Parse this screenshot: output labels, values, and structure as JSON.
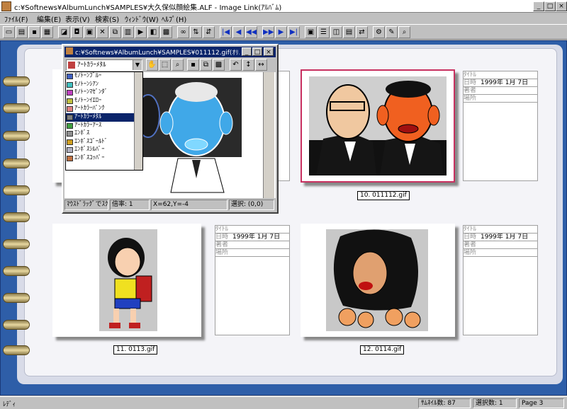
{
  "window": {
    "title": "c:¥Softnews¥AlbumLunch¥SAMPLES¥大久保似顔絵集.ALF - Image Link(ｱﾙﾊﾞﾑ)"
  },
  "menu": [
    "ﾌｧｲﾙ(F)",
    "編集(E)",
    "表示(V)",
    "検索(S)",
    "ｳｨﾝﾄﾞｳ(W)",
    "ﾍﾙﾌﾟ(H)"
  ],
  "album": {
    "cards": [
      {
        "caption": "10. 011112.gif",
        "title_label": "ﾀｲﾄﾙ",
        "date_label": "日時",
        "date": "1999年  1月  7日",
        "author_label": "著者",
        "place_label": "場所"
      },
      {
        "caption": "11. 0113.gif",
        "title_label": "ﾀｲﾄﾙ",
        "date_label": "日時",
        "date": "1999年  1月  7日",
        "author_label": "著者",
        "place_label": "場所"
      },
      {
        "caption": "12. 0114.gif",
        "title_label": "ﾀｲﾄﾙ",
        "date_label": "日時",
        "date": "1999年  1月  7日",
        "author_label": "著者",
        "place_label": "場所"
      },
      {
        "caption": "",
        "title_label": "ﾀｲﾄﾙ",
        "date_label": "日時",
        "date": "1999年  1月  7日",
        "author_label": "著者",
        "place_label": "場所"
      }
    ]
  },
  "viewer": {
    "title": "c:¥Softnews¥AlbumLunch¥SAMPLES¥011112.gif(ｵﾘ...",
    "filter_selected": "ｱｰﾄｶﾗｰﾒﾀﾙ",
    "filter_options": [
      "ﾓﾉﾄｰﾝﾌﾞﾙｰ",
      "ﾓﾉﾄｰﾝｼｱﾝ",
      "ﾓﾉﾄｰﾝﾏｾﾞﾝﾀﾞ",
      "ﾓﾉﾄｰﾝｲｴﾛｰ",
      "ｱｰﾄｶﾗｰﾊﾟﾝｸ",
      "ｱｰﾄｶﾗｰﾒﾀﾙ",
      "ｱｰﾄｶﾗｰｱｰｽ",
      "ｴﾝﾎﾞｽ",
      "ｴﾝﾎﾞｽｺﾞｰﾙﾄﾞ",
      "ｴﾝﾎﾞｽｼﾙﾊﾞｰ",
      "ｴﾝﾎﾞｽｺｯﾊﾟｰ"
    ],
    "status": {
      "hint": "ﾏｳｽﾄﾞﾗｯｸﾞでｽｸ",
      "zoom": "倍率: 1",
      "coords": "X=62,Y=-4",
      "selection": "選択: (0,0)"
    }
  },
  "statusbar": {
    "ready": "ﾚﾃﾞｨ",
    "thumbs_label": "ｻﾑﾈｲﾙ数:",
    "thumbs": "87",
    "selected_label": "選択数:",
    "selected": "1",
    "page": "Page 3"
  }
}
